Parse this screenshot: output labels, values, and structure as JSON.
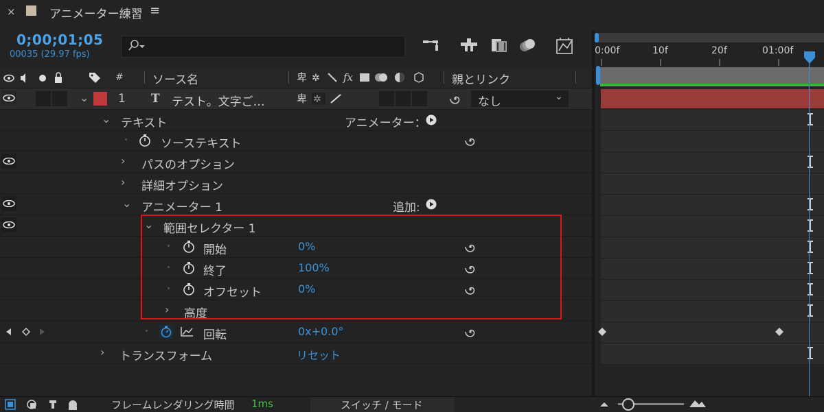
{
  "tab": {
    "close": "×",
    "title": "アニメーター練習",
    "menu": "≡"
  },
  "header": {
    "timecode": "0;00;01;05",
    "frame_info": "00035 (29.97 fps)"
  },
  "columns": {
    "source_name": "ソース名",
    "hash": "#",
    "parent_link": "親とリンク"
  },
  "layer": {
    "number": "1",
    "type_glyph": "T",
    "name": "テスト。文字ご…",
    "parent_value": "なし",
    "color": "#c0393b"
  },
  "rows": {
    "text": "テキスト",
    "animator_menu": "アニメーター：",
    "source_text": "ソーステキスト",
    "path_options": "パスのオプション",
    "more_options": "詳細オプション",
    "animator1": "アニメーター 1",
    "add": "追加:",
    "range_selector": "範囲セレクター 1",
    "start": {
      "label": "開始",
      "value": "0%"
    },
    "end": {
      "label": "終了",
      "value": "100%"
    },
    "offset": {
      "label": "オフセット",
      "value": "0%"
    },
    "advanced": "高度",
    "rotation": {
      "label": "回転",
      "value": "0x+0.0°"
    },
    "transform": "トランスフォーム",
    "reset": "リセット"
  },
  "timeline": {
    "ticks": [
      "0:00f",
      "10f",
      "20f",
      "01:00f"
    ],
    "playhead_color": "#3a8fd8",
    "bar_color": "#9b3b39",
    "work_area_color": "#3ab53a"
  },
  "footer": {
    "render_label": "フレームレンダリング時間",
    "render_value": "1ms",
    "switch_mode": "スイッチ / モード"
  },
  "colors": {
    "value_blue": "#3b93da",
    "highlight_red": "#e0141b"
  }
}
